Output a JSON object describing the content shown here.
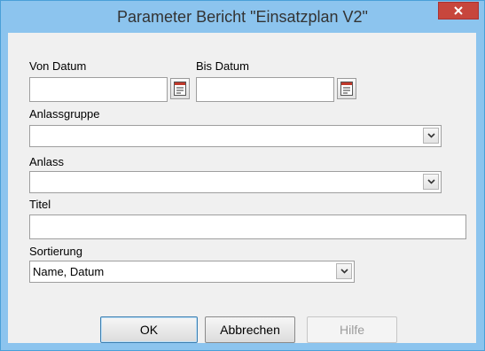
{
  "window": {
    "title": "Parameter Bericht \"Einsatzplan V2\"",
    "accent_color": "#8cc4ee",
    "close_icon": "close-icon"
  },
  "form": {
    "von_datum": {
      "label": "Von Datum",
      "value": ""
    },
    "bis_datum": {
      "label": "Bis Datum",
      "value": ""
    },
    "anlassgruppe": {
      "label": "Anlassgruppe",
      "value": ""
    },
    "anlass": {
      "label": "Anlass",
      "value": ""
    },
    "titel": {
      "label": "Titel",
      "value": ""
    },
    "sortierung": {
      "label": "Sortierung",
      "value": "Name, Datum"
    }
  },
  "buttons": {
    "ok": "OK",
    "cancel": "Abbrechen",
    "help": "Hilfe"
  }
}
